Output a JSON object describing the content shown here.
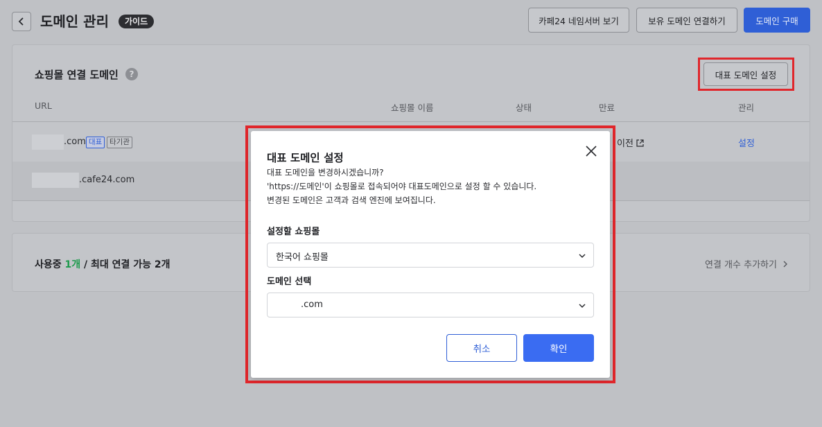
{
  "header": {
    "title": "도메인 관리",
    "guide_badge": "가이드",
    "buttons": {
      "nameserver": "카페24 네임서버 보기",
      "connect_owned": "보유 도메인 연결하기",
      "buy": "도메인 구매"
    }
  },
  "domains_section": {
    "title": "쇼핑몰 연결 도메인",
    "help": "?",
    "rep_button": "대표 도메인 설정",
    "columns": {
      "url": "URL",
      "shop_name": "쇼핑몰 이름",
      "status": "상태",
      "expire": "만료",
      "manage": "관리"
    },
    "rows": [
      {
        "url_suffix": ".com",
        "tag_rep": "대표",
        "tag_other": "타기관",
        "expire": "이전",
        "manage": "설정"
      },
      {
        "url_suffix": ".cafe24.com"
      }
    ]
  },
  "usage_section": {
    "prefix": "사용중 ",
    "count": "1개",
    "suffix": " / 최대 연결 가능 2개",
    "add_link": "연결 개수 추가하기"
  },
  "modal": {
    "title": "대표 도메인 설정",
    "desc_lines": [
      "대표 도메인을 변경하시겠습니까?",
      "'https://도메인'이 쇼핑몰로 접속되어야 대표도메인으로 설정 할 수 있습니다.",
      "변경된 도메인은 고객과 검색 엔진에 보여집니다."
    ],
    "shop_label": "설정할 쇼핑몰",
    "shop_value": "한국어 쇼핑몰",
    "domain_label": "도메인 선택",
    "domain_value": ".com",
    "cancel": "취소",
    "confirm": "확인"
  },
  "colors": {
    "primary": "#3a6cf2",
    "highlight": "#e0262b",
    "green": "#1d9a4c"
  },
  "icons": [
    "chevron-left-icon",
    "help-icon",
    "external-link-icon",
    "chevron-right-icon",
    "close-icon",
    "chevron-down-icon"
  ]
}
